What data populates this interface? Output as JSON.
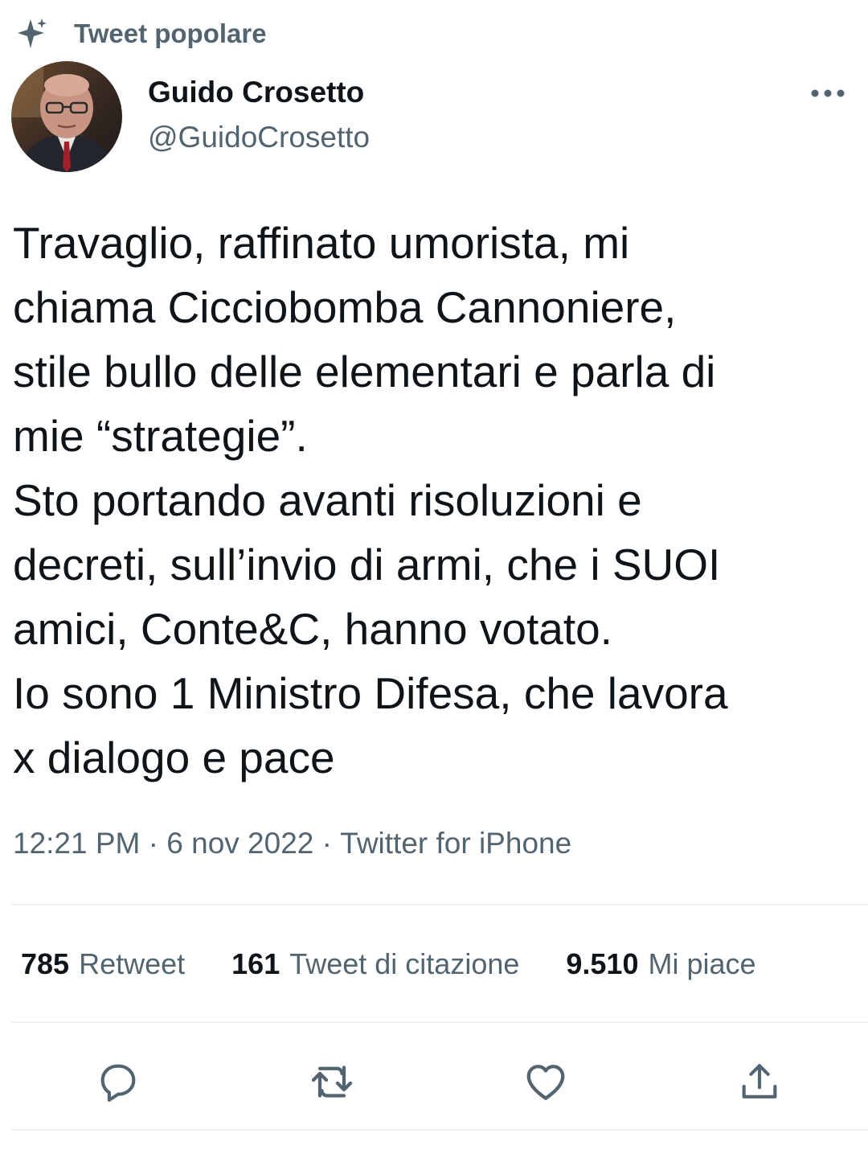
{
  "context": {
    "label": "Tweet popolare",
    "icon": "sparkle-icon"
  },
  "author": {
    "name": "Guido Crosetto",
    "handle": "@GuidoCrosetto",
    "avatar": "avatar-photo"
  },
  "tweet": {
    "text": "Travaglio, raffinato umorista, mi\nchiama Cicciobomba Cannoniere,\nstile bullo delle elementari e parla di\nmie “strategie”.\nSto portando avanti risoluzioni e\ndecreti, sull’invio di armi, che i SUOI\namici, Conte&C, hanno votato.\nIo sono 1 Ministro Difesa, che lavora\nx dialogo e pace"
  },
  "meta": {
    "time": "12:21 PM",
    "separator": " · ",
    "date": "6 nov 2022",
    "source": "Twitter for iPhone"
  },
  "stats": [
    {
      "count": "785",
      "label": "Retweet"
    },
    {
      "count": "161",
      "label": "Tweet di citazione"
    },
    {
      "count": "9.510",
      "label": "Mi piace"
    }
  ],
  "actions": [
    {
      "name": "reply",
      "icon": "reply-icon"
    },
    {
      "name": "retweet",
      "icon": "retweet-icon"
    },
    {
      "name": "like",
      "icon": "heart-icon"
    },
    {
      "name": "share",
      "icon": "share-icon"
    }
  ],
  "colors": {
    "primary_text": "#0f1419",
    "secondary_text": "#536471",
    "divider": "#eff3f4"
  }
}
